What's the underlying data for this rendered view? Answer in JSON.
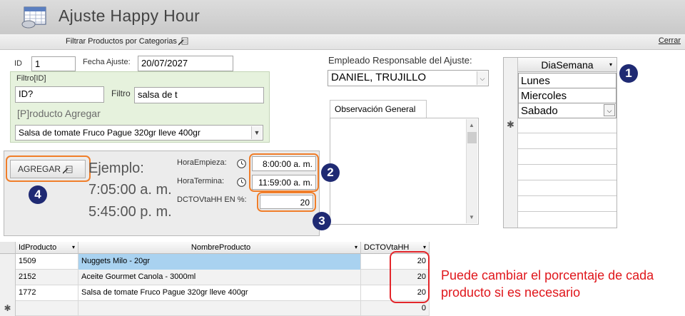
{
  "window": {
    "title": "Ajuste Happy Hour",
    "menu_filter": "Filtrar Productos por Categorias",
    "close": "Cerrar"
  },
  "header": {
    "id_label": "ID",
    "id_value": "1",
    "fecha_label": "Fecha Ajuste:",
    "fecha_value": "20/07/2027"
  },
  "filter": {
    "group_label": "Filtro[ID]",
    "id_value": "ID?",
    "filtro_label": "Filtro",
    "filtro_value": "salsa de t",
    "producto_label": "[P]roducto Agregar",
    "producto_value": "Salsa de tomate Fruco Pague 320gr lleve 400gr"
  },
  "employee": {
    "label": "Empleado Responsable del Ajuste:",
    "value": "DANIEL, TRUJILLO"
  },
  "observacion": {
    "tab_label": "Observación General"
  },
  "dia_semana": {
    "header": "DiaSemana",
    "rows": [
      "Lunes",
      "Miercoles",
      "Sabado"
    ],
    "new_row_marker": "✱"
  },
  "timing": {
    "add_button": "AGREGAR",
    "ejemplo_title": "Ejemplo:",
    "ejemplo_1": "7:05:00 a. m.",
    "ejemplo_2": "5:45:00 p. m.",
    "hora_empieza_label": "HoraEmpieza:",
    "hora_empieza_value": "8:00:00 a. m.",
    "hora_termina_label": "HoraTermina:",
    "hora_termina_value": "11:59:00 a. m.",
    "dcto_label": "DCTOVtaHH EN %:",
    "dcto_value": "20"
  },
  "markers": [
    "1",
    "2",
    "3",
    "4"
  ],
  "products": {
    "columns": [
      "IdProducto",
      "NombreProducto",
      "DCTOVtaHH"
    ],
    "rows": [
      {
        "id": "1509",
        "name": "Nuggets Milo - 20gr",
        "dcto": "20"
      },
      {
        "id": "2152",
        "name": "Aceite Gourmet Canola - 3000ml",
        "dcto": "20"
      },
      {
        "id": "1772",
        "name": "Salsa de tomate Fruco Pague 320gr lleve 400gr",
        "dcto": "20"
      }
    ],
    "new_row": {
      "marker": "✱",
      "dcto": "0"
    }
  },
  "annotation": "Puede cambiar el porcentaje de cada producto si es necesario",
  "colors": {
    "accent_orange": "#f07e2a",
    "marker_navy": "#1f2a73",
    "annotation_red": "#e0161b",
    "filter_green": "#e6f2dd",
    "row_highlight": "#a9d2f0"
  },
  "icons": {
    "app": "calendar-form-icon",
    "filter": "filter-wand-icon",
    "clock": "clock-icon",
    "dropdown": "chevron-down-icon"
  }
}
